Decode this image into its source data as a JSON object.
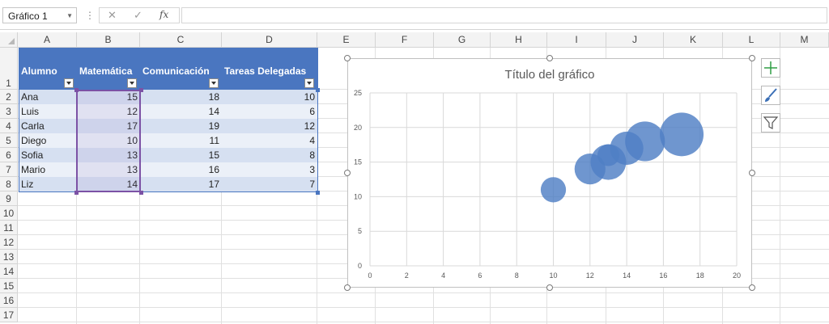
{
  "formula_bar": {
    "name_box": "Gráfico 1",
    "fx_label": "fx",
    "formula": ""
  },
  "sheet": {
    "columns": [
      "A",
      "B",
      "C",
      "D",
      "E",
      "F",
      "G",
      "H",
      "I",
      "J",
      "K",
      "L",
      "M"
    ],
    "rows": [
      "1",
      "2",
      "3",
      "4",
      "5",
      "6",
      "7",
      "8",
      "9",
      "10",
      "11",
      "12",
      "13",
      "14",
      "15",
      "16",
      "17"
    ]
  },
  "table": {
    "headers": [
      "Alumno",
      "Matemática",
      "Comunicación",
      "Tareas Delegadas"
    ],
    "rows": [
      [
        "Ana",
        "15",
        "18",
        "10"
      ],
      [
        "Luis",
        "12",
        "14",
        "6"
      ],
      [
        "Carla",
        "17",
        "19",
        "12"
      ],
      [
        "Diego",
        "10",
        "11",
        "4"
      ],
      [
        "Sofia",
        "13",
        "15",
        "8"
      ],
      [
        "Mario",
        "13",
        "16",
        "3"
      ],
      [
        "Liz",
        "14",
        "17",
        "7"
      ]
    ]
  },
  "chart_data": {
    "type": "scatter",
    "title": "Título del gráfico",
    "bubble": true,
    "xlim": [
      0,
      20
    ],
    "ylim": [
      0,
      25
    ],
    "xticks": [
      "0",
      "2",
      "4",
      "6",
      "8",
      "10",
      "12",
      "14",
      "16",
      "18",
      "20"
    ],
    "yticks": [
      "0",
      "5",
      "10",
      "15",
      "20",
      "25"
    ],
    "grid": true,
    "color": "#4f7fc4",
    "points": [
      {
        "x": 15,
        "y": 18,
        "size": 10
      },
      {
        "x": 12,
        "y": 14,
        "size": 6
      },
      {
        "x": 17,
        "y": 19,
        "size": 12
      },
      {
        "x": 10,
        "y": 11,
        "size": 4
      },
      {
        "x": 13,
        "y": 15,
        "size": 8
      },
      {
        "x": 13,
        "y": 16,
        "size": 3
      },
      {
        "x": 14,
        "y": 17,
        "size": 7
      }
    ]
  },
  "chart_tools": [
    "plus-icon",
    "brush-icon",
    "filter-icon"
  ]
}
